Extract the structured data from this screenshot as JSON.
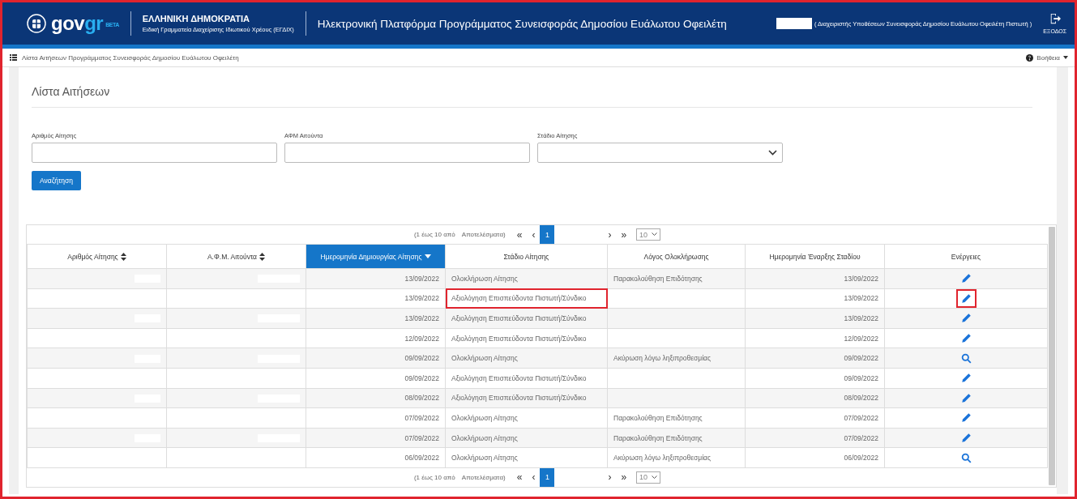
{
  "header": {
    "logo_text": "gov",
    "logo_accent": "gr",
    "logo_badge": "BETA",
    "org_title": "ΕΛΛΗΝΙΚΗ ΔΗΜΟΚΡΑΤΙΑ",
    "org_subtitle": "Ειδική Γραμματεία Διαχείρισης Ιδιωτικού Χρέους (ΕΓΔΙΧ)",
    "title": "Ηλεκτρονική Πλατφόρμα Προγράμματος Συνεισφοράς Δημοσίου Ευάλωτου Οφειλέτη",
    "user_redacted": true,
    "user_role": "( Διαχειριστής Υποθέσεων Συνεισφοράς Δημοσίου Ευάλωτου Οφειλέτη Πιστωτή )",
    "exit_label": "ΕΞΟΔΟΣ"
  },
  "breadcrumb": {
    "label": "Λίστα Αιτήσεων Προγράμματος Συνεισφοράς Δημοσίου Ευάλωτου Οφειλέτη",
    "help": "Βοήθεια"
  },
  "page_title": "Λίστα Αιτήσεων",
  "filters": [
    {
      "kind": "text",
      "label": "Αριθμός Αίτησης"
    },
    {
      "kind": "text",
      "label": "ΑΦΜ Αιτούντα"
    },
    {
      "kind": "select",
      "label": "Στάδιο Αίτησης"
    }
  ],
  "search_button": "Αναζήτηση",
  "pagination_top": {
    "range": "(1 έως 10 από",
    "results": "Αποτελέσματα)",
    "first": "«",
    "prev": "‹",
    "pages": [
      {
        "label": "1",
        "selected": true
      }
    ],
    "next": "›",
    "last": "»",
    "page_size": "10"
  },
  "pagination_bottom": {
    "range": "(1 έως 10 από",
    "results": "Αποτελέσματα)",
    "first": "«",
    "prev": "‹",
    "pages": [
      {
        "label": "1",
        "selected": true
      }
    ],
    "next": "›",
    "last": "»",
    "page_size": "10"
  },
  "table": {
    "columns": [
      {
        "label": "Αριθμός Αίτησης",
        "sortable": true,
        "selected": false
      },
      {
        "label": "Α.Φ.Μ. Αιτούντα",
        "sortable": true,
        "selected": false
      },
      {
        "label": "Ημερομηνία Δημιουργίας Αίτησης",
        "sortable": true,
        "selected": true
      },
      {
        "label": "Στάδιο Αίτησης",
        "sortable": false,
        "selected": false
      },
      {
        "label": "Λόγος Ολοκλήρωσης",
        "sortable": false,
        "selected": false
      },
      {
        "label": "Ημερομηνία Έναρξης Σταδίου",
        "sortable": false,
        "selected": false
      },
      {
        "label": "Ενέργειες",
        "sortable": false,
        "selected": false
      }
    ],
    "rows": [
      {
        "kind": "edit",
        "redacted": true,
        "created": "13/09/2022",
        "stage": "Ολοκλήρωση Αίτησης",
        "reason": "Παρακολούθηση Επιδότησης",
        "stage_start": "13/09/2022",
        "highlighted": false
      },
      {
        "kind": "edit",
        "redacted": false,
        "created": "13/09/2022",
        "stage": "Αξιολόγηση Επισπεύδοντα Πιστωτή/Σύνδικο",
        "stage_start": "13/09/2022",
        "highlighted": true
      },
      {
        "kind": "edit",
        "redacted": true,
        "created": "13/09/2022",
        "stage": "Αξιολόγηση Επισπεύδοντα Πιστωτή/Σύνδικο",
        "stage_start": "13/09/2022",
        "highlighted": false
      },
      {
        "kind": "edit",
        "redacted": false,
        "created": "12/09/2022",
        "stage": "Αξιολόγηση Επισπεύδοντα Πιστωτή/Σύνδικο",
        "stage_start": "12/09/2022",
        "highlighted": false
      },
      {
        "kind": "view",
        "redacted": true,
        "created": "09/09/2022",
        "stage": "Ολοκλήρωση Αίτησης",
        "reason": "Ακύρωση λόγω ληξιπροθεσμίας",
        "stage_start": "09/09/2022",
        "highlighted": false
      },
      {
        "kind": "edit",
        "redacted": false,
        "created": "09/09/2022",
        "stage": "Αξιολόγηση Επισπεύδοντα Πιστωτή/Σύνδικο",
        "stage_start": "09/09/2022",
        "highlighted": false
      },
      {
        "kind": "edit",
        "redacted": true,
        "created": "08/09/2022",
        "stage": "Αξιολόγηση Επισπεύδοντα Πιστωτή/Σύνδικο",
        "stage_start": "08/09/2022",
        "highlighted": false
      },
      {
        "kind": "edit",
        "redacted": false,
        "created": "07/09/2022",
        "stage": "Ολοκλήρωση Αίτησης",
        "reason": "Παρακολούθηση Επιδότησης",
        "stage_start": "07/09/2022",
        "highlighted": false
      },
      {
        "kind": "edit",
        "redacted": true,
        "created": "07/09/2022",
        "stage": "Ολοκλήρωση Αίτησης",
        "reason": "Παρακολούθηση Επιδότησης",
        "stage_start": "07/09/2022",
        "highlighted": false
      },
      {
        "kind": "view",
        "redacted": false,
        "created": "06/09/2022",
        "stage": "Ολοκλήρωση Αίτησης",
        "reason": "Ακύρωση λόγω ληξιπροθεσμίας",
        "stage_start": "06/09/2022",
        "highlighted": false
      }
    ]
  }
}
